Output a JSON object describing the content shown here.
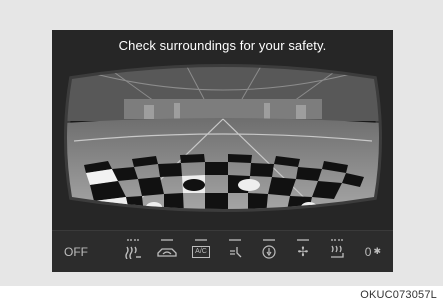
{
  "screen": {
    "headline": "Check surroundings for your safety."
  },
  "climate_bar": {
    "off_label": "OFF",
    "fan_speed": "0",
    "controls": [
      {
        "name": "rear-defrost-heated-seat-icon"
      },
      {
        "name": "air-recirculation-icon"
      },
      {
        "name": "ac-icon",
        "text": "A/C"
      },
      {
        "name": "airflow-mode-icon"
      },
      {
        "name": "auto-climate-icon"
      },
      {
        "name": "fan-icon"
      },
      {
        "name": "heated-seat-icon"
      }
    ]
  },
  "caption": "OKUC073057L",
  "colors": {
    "screen_bg": "#262626",
    "panel_bg": "#e6e6e6",
    "text_light": "#ffffff"
  }
}
